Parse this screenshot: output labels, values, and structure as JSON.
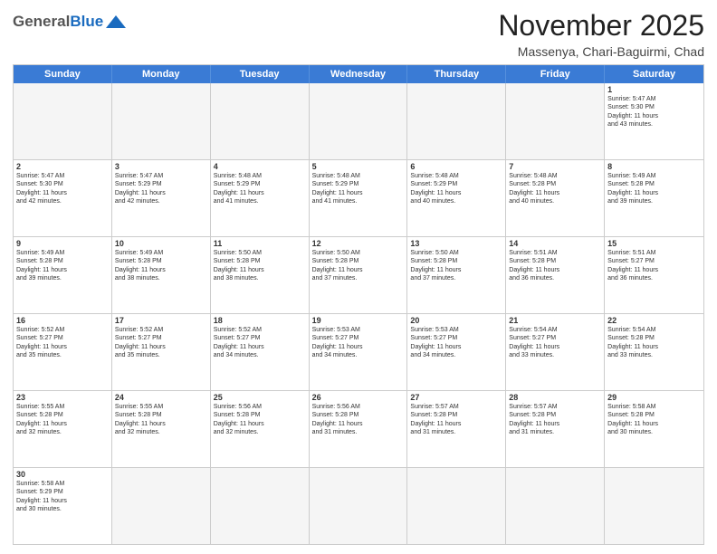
{
  "header": {
    "logo_general": "General",
    "logo_blue": "Blue",
    "month_year": "November 2025",
    "location": "Massenya, Chari-Baguirmi, Chad"
  },
  "days_of_week": [
    "Sunday",
    "Monday",
    "Tuesday",
    "Wednesday",
    "Thursday",
    "Friday",
    "Saturday"
  ],
  "weeks": [
    [
      {
        "day": "",
        "text": "",
        "empty": true
      },
      {
        "day": "",
        "text": "",
        "empty": true
      },
      {
        "day": "",
        "text": "",
        "empty": true
      },
      {
        "day": "",
        "text": "",
        "empty": true
      },
      {
        "day": "",
        "text": "",
        "empty": true
      },
      {
        "day": "",
        "text": "",
        "empty": true
      },
      {
        "day": "1",
        "text": "Sunrise: 5:47 AM\nSunset: 5:30 PM\nDaylight: 11 hours\nand 43 minutes.",
        "empty": false
      }
    ],
    [
      {
        "day": "2",
        "text": "Sunrise: 5:47 AM\nSunset: 5:30 PM\nDaylight: 11 hours\nand 42 minutes.",
        "empty": false
      },
      {
        "day": "3",
        "text": "Sunrise: 5:47 AM\nSunset: 5:29 PM\nDaylight: 11 hours\nand 42 minutes.",
        "empty": false
      },
      {
        "day": "4",
        "text": "Sunrise: 5:48 AM\nSunset: 5:29 PM\nDaylight: 11 hours\nand 41 minutes.",
        "empty": false
      },
      {
        "day": "5",
        "text": "Sunrise: 5:48 AM\nSunset: 5:29 PM\nDaylight: 11 hours\nand 41 minutes.",
        "empty": false
      },
      {
        "day": "6",
        "text": "Sunrise: 5:48 AM\nSunset: 5:29 PM\nDaylight: 11 hours\nand 40 minutes.",
        "empty": false
      },
      {
        "day": "7",
        "text": "Sunrise: 5:48 AM\nSunset: 5:28 PM\nDaylight: 11 hours\nand 40 minutes.",
        "empty": false
      },
      {
        "day": "8",
        "text": "Sunrise: 5:49 AM\nSunset: 5:28 PM\nDaylight: 11 hours\nand 39 minutes.",
        "empty": false
      }
    ],
    [
      {
        "day": "9",
        "text": "Sunrise: 5:49 AM\nSunset: 5:28 PM\nDaylight: 11 hours\nand 39 minutes.",
        "empty": false
      },
      {
        "day": "10",
        "text": "Sunrise: 5:49 AM\nSunset: 5:28 PM\nDaylight: 11 hours\nand 38 minutes.",
        "empty": false
      },
      {
        "day": "11",
        "text": "Sunrise: 5:50 AM\nSunset: 5:28 PM\nDaylight: 11 hours\nand 38 minutes.",
        "empty": false
      },
      {
        "day": "12",
        "text": "Sunrise: 5:50 AM\nSunset: 5:28 PM\nDaylight: 11 hours\nand 37 minutes.",
        "empty": false
      },
      {
        "day": "13",
        "text": "Sunrise: 5:50 AM\nSunset: 5:28 PM\nDaylight: 11 hours\nand 37 minutes.",
        "empty": false
      },
      {
        "day": "14",
        "text": "Sunrise: 5:51 AM\nSunset: 5:28 PM\nDaylight: 11 hours\nand 36 minutes.",
        "empty": false
      },
      {
        "day": "15",
        "text": "Sunrise: 5:51 AM\nSunset: 5:27 PM\nDaylight: 11 hours\nand 36 minutes.",
        "empty": false
      }
    ],
    [
      {
        "day": "16",
        "text": "Sunrise: 5:52 AM\nSunset: 5:27 PM\nDaylight: 11 hours\nand 35 minutes.",
        "empty": false
      },
      {
        "day": "17",
        "text": "Sunrise: 5:52 AM\nSunset: 5:27 PM\nDaylight: 11 hours\nand 35 minutes.",
        "empty": false
      },
      {
        "day": "18",
        "text": "Sunrise: 5:52 AM\nSunset: 5:27 PM\nDaylight: 11 hours\nand 34 minutes.",
        "empty": false
      },
      {
        "day": "19",
        "text": "Sunrise: 5:53 AM\nSunset: 5:27 PM\nDaylight: 11 hours\nand 34 minutes.",
        "empty": false
      },
      {
        "day": "20",
        "text": "Sunrise: 5:53 AM\nSunset: 5:27 PM\nDaylight: 11 hours\nand 34 minutes.",
        "empty": false
      },
      {
        "day": "21",
        "text": "Sunrise: 5:54 AM\nSunset: 5:27 PM\nDaylight: 11 hours\nand 33 minutes.",
        "empty": false
      },
      {
        "day": "22",
        "text": "Sunrise: 5:54 AM\nSunset: 5:28 PM\nDaylight: 11 hours\nand 33 minutes.",
        "empty": false
      }
    ],
    [
      {
        "day": "23",
        "text": "Sunrise: 5:55 AM\nSunset: 5:28 PM\nDaylight: 11 hours\nand 32 minutes.",
        "empty": false
      },
      {
        "day": "24",
        "text": "Sunrise: 5:55 AM\nSunset: 5:28 PM\nDaylight: 11 hours\nand 32 minutes.",
        "empty": false
      },
      {
        "day": "25",
        "text": "Sunrise: 5:56 AM\nSunset: 5:28 PM\nDaylight: 11 hours\nand 32 minutes.",
        "empty": false
      },
      {
        "day": "26",
        "text": "Sunrise: 5:56 AM\nSunset: 5:28 PM\nDaylight: 11 hours\nand 31 minutes.",
        "empty": false
      },
      {
        "day": "27",
        "text": "Sunrise: 5:57 AM\nSunset: 5:28 PM\nDaylight: 11 hours\nand 31 minutes.",
        "empty": false
      },
      {
        "day": "28",
        "text": "Sunrise: 5:57 AM\nSunset: 5:28 PM\nDaylight: 11 hours\nand 31 minutes.",
        "empty": false
      },
      {
        "day": "29",
        "text": "Sunrise: 5:58 AM\nSunset: 5:28 PM\nDaylight: 11 hours\nand 30 minutes.",
        "empty": false
      }
    ],
    [
      {
        "day": "30",
        "text": "Sunrise: 5:58 AM\nSunset: 5:29 PM\nDaylight: 11 hours\nand 30 minutes.",
        "empty": false
      },
      {
        "day": "",
        "text": "",
        "empty": true
      },
      {
        "day": "",
        "text": "",
        "empty": true
      },
      {
        "day": "",
        "text": "",
        "empty": true
      },
      {
        "day": "",
        "text": "",
        "empty": true
      },
      {
        "day": "",
        "text": "",
        "empty": true
      },
      {
        "day": "",
        "text": "",
        "empty": true
      }
    ]
  ]
}
